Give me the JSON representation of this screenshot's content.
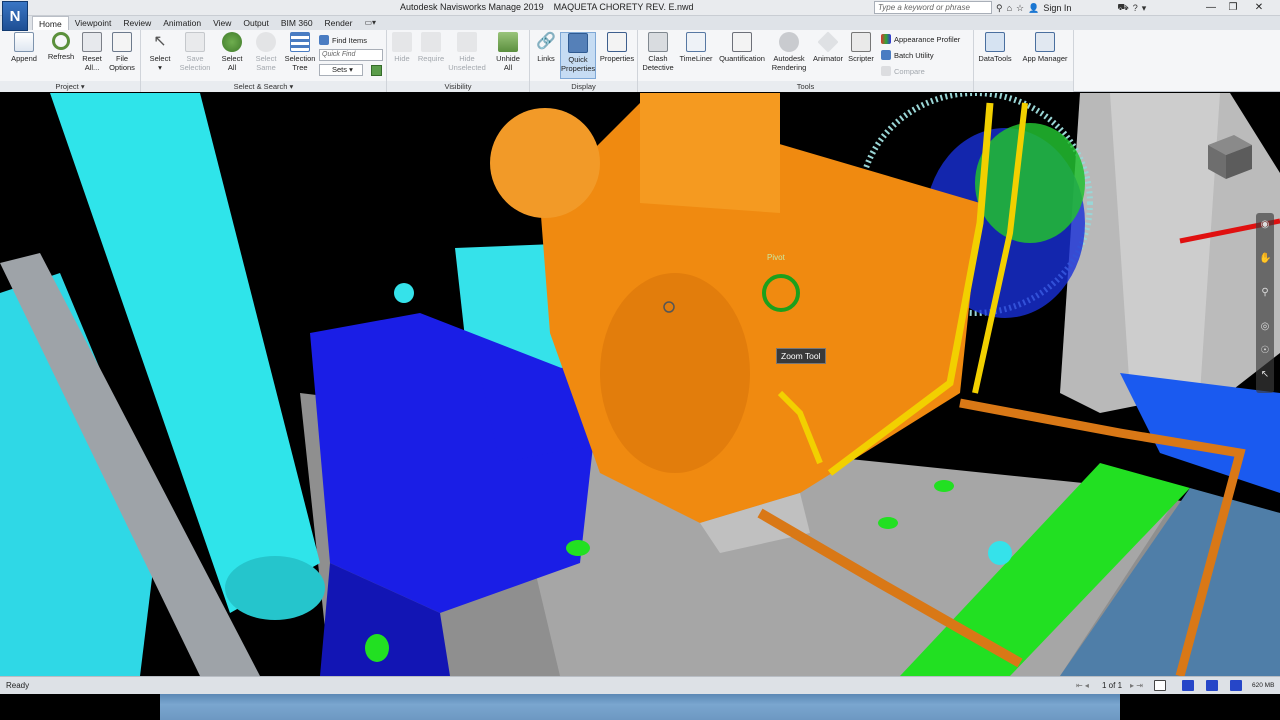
{
  "app": {
    "logo_letter": "N",
    "title": "Autodesk Navisworks Manage 2019    MAQUETA CHORETY REV. E.nwd",
    "search_placeholder": "Type a keyword or phrase",
    "sign_in": "Sign In"
  },
  "tabs": [
    "Home",
    "Viewpoint",
    "Review",
    "Animation",
    "View",
    "Output",
    "BIM 360",
    "Render"
  ],
  "ribbon": {
    "project": {
      "label": "Project",
      "append": "Append",
      "refresh": "Refresh",
      "reset_all_1": "Reset",
      "reset_all_2": "All...",
      "file_options_1": "File",
      "file_options_2": "Options"
    },
    "select_search": {
      "label": "Select & Search",
      "select": "Select",
      "save_selection_1": "Save",
      "save_selection_2": "Selection",
      "select_all_1": "Select",
      "select_all_2": "All",
      "select_same_1": "Select",
      "select_same_2": "Same",
      "selection_tree_1": "Selection",
      "selection_tree_2": "Tree",
      "find_items": "Find Items",
      "quick_find_placeholder": "Quick Find",
      "sets": "Sets"
    },
    "visibility": {
      "label": "Visibility",
      "hide": "Hide",
      "require": "Require",
      "hide_unselected_1": "Hide",
      "hide_unselected_2": "Unselected",
      "unhide_all_1": "Unhide",
      "unhide_all_2": "All"
    },
    "display": {
      "label": "Display",
      "links": "Links",
      "quick_properties_1": "Quick",
      "quick_properties_2": "Properties",
      "properties": "Properties"
    },
    "tools": {
      "label": "Tools",
      "clash_detective_1": "Clash",
      "clash_detective_2": "Detective",
      "timeliner": "TimeLiner",
      "quantification": "Quantification",
      "autodesk_rendering_1": "Autodesk",
      "autodesk_rendering_2": "Rendering",
      "animator": "Animator",
      "scripter": "Scripter",
      "appearance_profiler": "Appearance Profiler",
      "batch_utility": "Batch Utility",
      "compare": "Compare"
    },
    "datatools": "DataTools",
    "app_manager": "App Manager"
  },
  "viewport": {
    "tooltip": "Zoom Tool",
    "pivot_label": "Pivot"
  },
  "status": {
    "text": "Ready",
    "page": "1 of 1",
    "memory": "620 MB"
  },
  "colors": {
    "engine": "#f08a10",
    "cyan": "#2fe4ea",
    "blue": "#1a1ee6",
    "green": "#28e828",
    "yellow": "#f2e000",
    "floor": "#9a9a9a"
  }
}
